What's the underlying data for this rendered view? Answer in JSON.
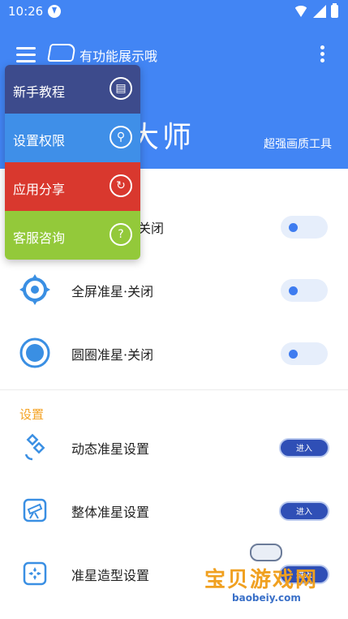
{
  "status_bar": {
    "time": "10:26"
  },
  "header": {
    "title": "有功能展示哦",
    "app_title_visible": "大师",
    "subtitle": "超强画质工具"
  },
  "menu": {
    "items": [
      {
        "label": "新手教程",
        "icon": "book-icon",
        "color": "#3d4b8c"
      },
      {
        "label": "设置权限",
        "icon": "key-icon",
        "color": "#3f8fe8"
      },
      {
        "label": "应用分享",
        "icon": "share-icon",
        "color": "#d9382e"
      },
      {
        "label": "客服咨询",
        "icon": "question-icon",
        "color": "#93c93a"
      }
    ]
  },
  "list": {
    "toggles": [
      {
        "label": "关闭",
        "icon": "crosshair-dot-icon"
      },
      {
        "label": "全屏准星·关闭",
        "icon": "crosshair-target-icon"
      },
      {
        "label": "圆圈准星·关闭",
        "icon": "circle-dot-icon"
      }
    ],
    "section_title": "设置",
    "settings": [
      {
        "label": "动态准星设置",
        "button": "进入",
        "icon": "satellite-icon"
      },
      {
        "label": "整体准星设置",
        "button": "进入",
        "icon": "telescope-icon"
      },
      {
        "label": "准星造型设置",
        "button": "进入",
        "icon": "gamepad-icon"
      }
    ]
  },
  "watermark": {
    "text": "宝贝游戏网",
    "url": "baobeiy.com"
  },
  "colors": {
    "header_blue": "#4285f4",
    "accent_orange": "#f4a325",
    "button_navy": "#2f4fb6"
  }
}
